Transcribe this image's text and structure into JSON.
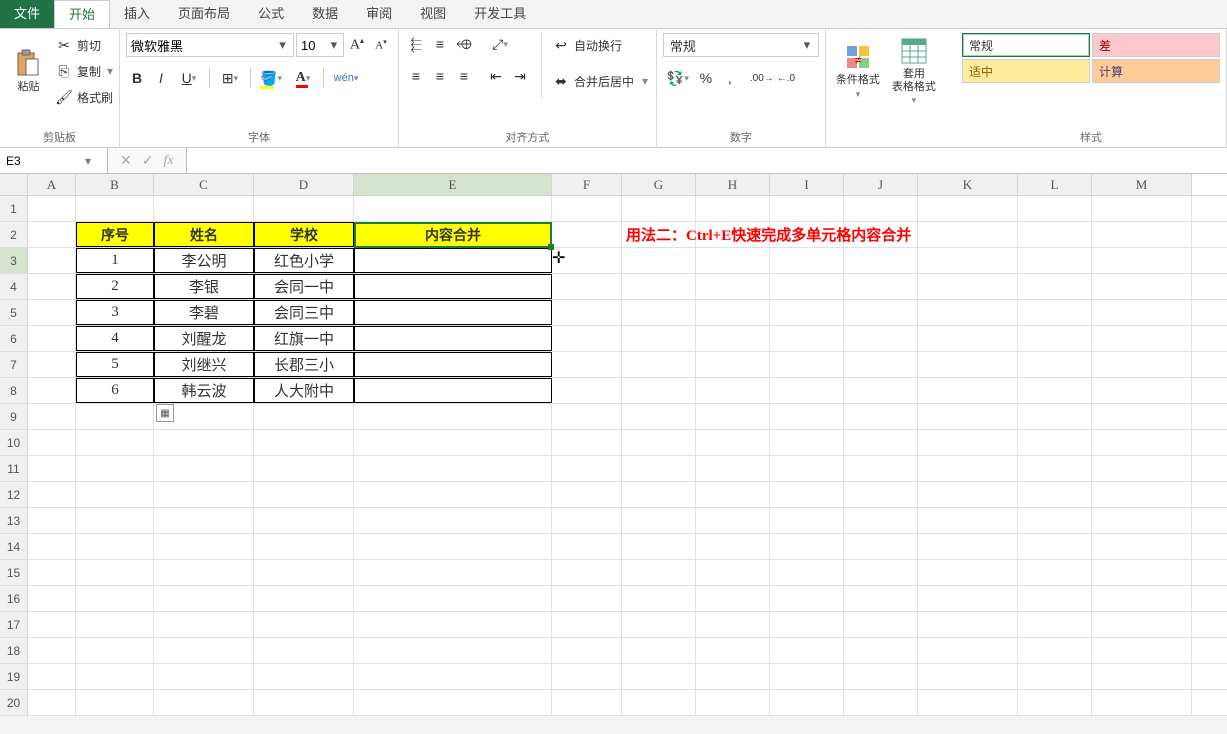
{
  "tabs": {
    "file": "文件",
    "home": "开始",
    "insert": "插入",
    "layout": "页面布局",
    "formula": "公式",
    "data": "数据",
    "review": "审阅",
    "view": "视图",
    "dev": "开发工具"
  },
  "ribbon": {
    "clipboard": {
      "title": "剪贴板",
      "paste": "粘贴",
      "cut": "剪切",
      "copy": "复制",
      "fmtpainter": "格式刷"
    },
    "font": {
      "title": "字体",
      "name": "微软雅黑",
      "size": "10",
      "bold": "B",
      "italic": "I",
      "underline": "U"
    },
    "align": {
      "title": "对齐方式",
      "wrap": "自动换行",
      "merge": "合并后居中"
    },
    "number": {
      "title": "数字",
      "format": "常规"
    },
    "styles_grp": {
      "title": "样式",
      "cond": "条件格式",
      "tablefmt": "套用\n表格格式"
    },
    "styles": {
      "normal": "常规",
      "bad": "差",
      "neutral": "适中",
      "calc": "计算"
    }
  },
  "namebox": "E3",
  "columns": [
    "A",
    "B",
    "C",
    "D",
    "E",
    "F",
    "G",
    "H",
    "I",
    "J",
    "K",
    "L",
    "M"
  ],
  "row_count": 20,
  "table": {
    "headers": {
      "num": "序号",
      "name": "姓名",
      "school": "学校",
      "merge": "内容合并"
    },
    "rows": [
      {
        "num": "1",
        "name": "李公明",
        "school": "红色小学"
      },
      {
        "num": "2",
        "name": "李银",
        "school": "会同一中"
      },
      {
        "num": "3",
        "name": "李碧",
        "school": "会同三中"
      },
      {
        "num": "4",
        "name": "刘醒龙",
        "school": "红旗一中"
      },
      {
        "num": "5",
        "name": "刘继兴",
        "school": "长郡三小"
      },
      {
        "num": "6",
        "name": "韩云波",
        "school": "人大附中"
      }
    ]
  },
  "note": "用法二：Ctrl+E快速完成多单元格内容合并"
}
